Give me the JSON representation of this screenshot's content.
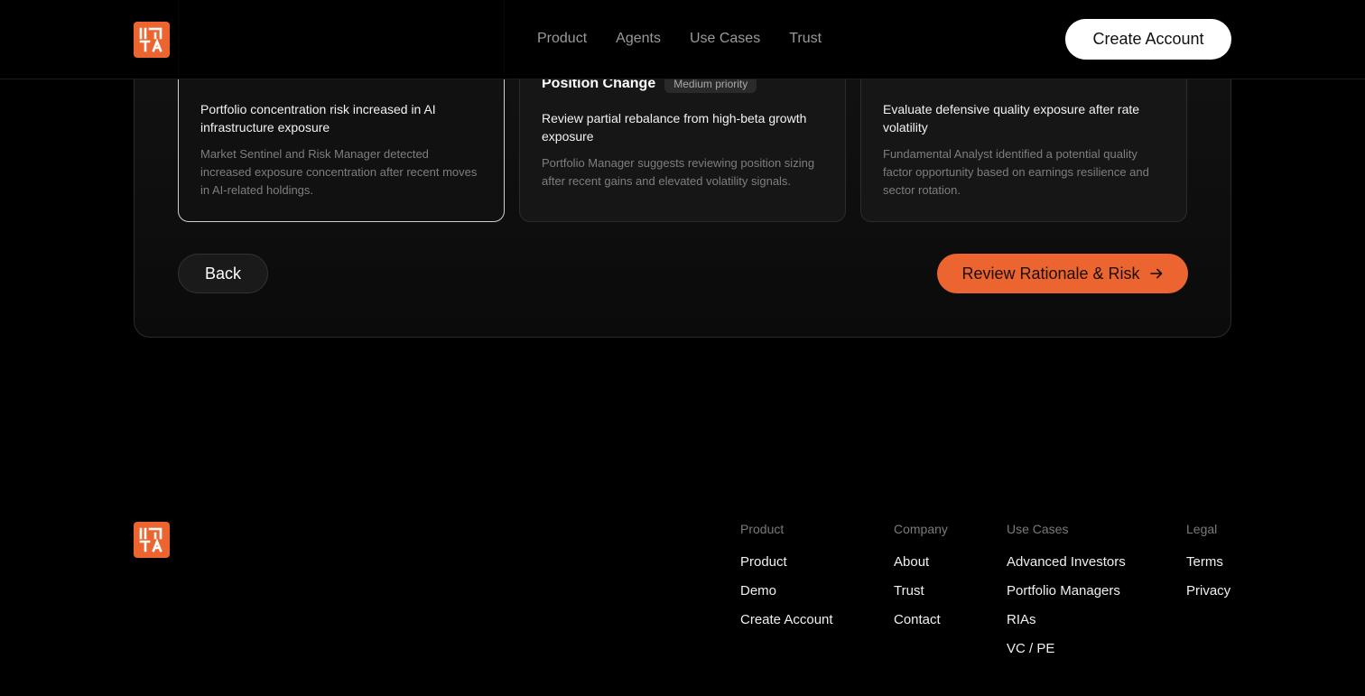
{
  "header": {
    "nav": [
      "Product",
      "Agents",
      "Use Cases",
      "Trust"
    ],
    "cta_label": "Create Account"
  },
  "cards": [
    {
      "title": "",
      "priority": "",
      "subtitle": "Portfolio concentration risk increased in AI infrastructure exposure",
      "description": "Market Sentinel and Risk Manager detected increased exposure concentration after recent moves in AI-related holdings.",
      "selected": true
    },
    {
      "title": "Position Change",
      "priority": "Medium priority",
      "subtitle": "Review partial rebalance from high-beta growth exposure",
      "description": "Portfolio Manager suggests reviewing position sizing after recent gains and elevated volatility signals.",
      "selected": false
    },
    {
      "title": "",
      "priority": "",
      "subtitle": "Evaluate defensive quality exposure after rate volatility",
      "description": "Fundamental Analyst identified a potential quality factor opportunity based on earnings resilience and sector rotation.",
      "selected": false
    }
  ],
  "actions": {
    "back_label": "Back",
    "review_label": "Review Rationale & Risk",
    "review_icon": "arrow-right-icon"
  },
  "footer": {
    "columns": [
      {
        "heading": "Product",
        "links": [
          "Product",
          "Demo",
          "Create Account"
        ]
      },
      {
        "heading": "Company",
        "links": [
          "About",
          "Trust",
          "Contact"
        ]
      },
      {
        "heading": "Use Cases",
        "links": [
          "Advanced Investors",
          "Portfolio Managers",
          "RIAs",
          "VC / PE"
        ]
      },
      {
        "heading": "Legal",
        "links": [
          "Terms",
          "Privacy"
        ]
      }
    ]
  },
  "colors": {
    "accent": "#ec6530",
    "background": "#000000",
    "card": "#161616"
  }
}
